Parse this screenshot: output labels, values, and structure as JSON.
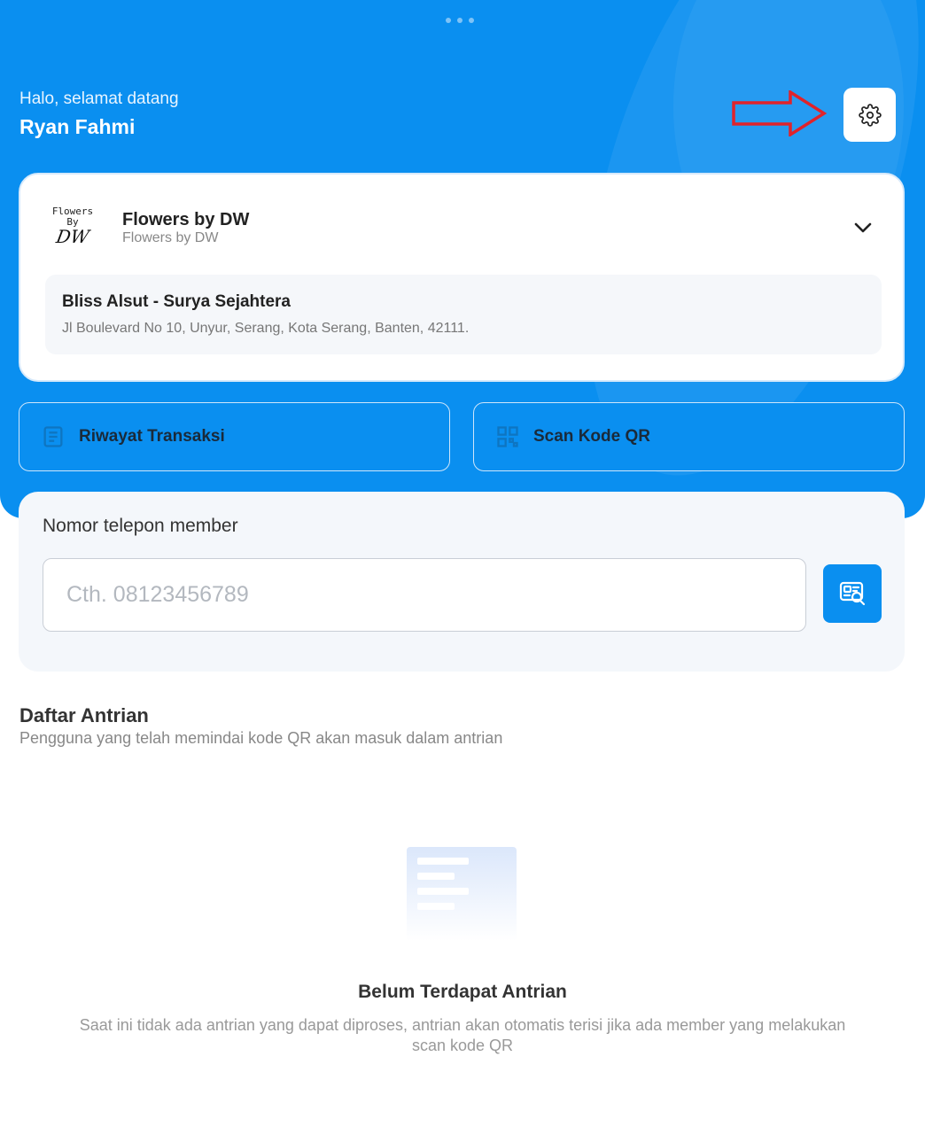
{
  "header": {
    "greeting": "Halo, selamat datang",
    "username": "Ryan Fahmi",
    "settings_icon": "gear-icon",
    "annotation_arrow_color": "#e0232b"
  },
  "store": {
    "logo_line1": "Flowers",
    "logo_line2": "By",
    "logo_line3": "DW",
    "name": "Flowers by DW",
    "subtitle": "Flowers by DW",
    "branch_name": "Bliss Alsut - Surya Sejahtera",
    "branch_address": "Jl Boulevard No 10, Unyur, Serang, Kota Serang, Banten, 42111."
  },
  "actions": {
    "history_label": "Riwayat Transaksi",
    "scan_label": "Scan Kode QR"
  },
  "member": {
    "label": "Nomor telepon member",
    "placeholder": "Cth. 08123456789",
    "value": ""
  },
  "queue": {
    "title": "Daftar Antrian",
    "subtitle": "Pengguna yang telah memindai kode QR akan masuk dalam antrian",
    "empty_title": "Belum Terdapat Antrian",
    "empty_desc": "Saat ini tidak ada antrian yang dapat diproses, antrian akan otomatis terisi jika ada member yang melakukan scan kode QR"
  },
  "colors": {
    "primary": "#0a8ff0",
    "card_bg": "#ffffff",
    "muted_text": "#888888"
  }
}
